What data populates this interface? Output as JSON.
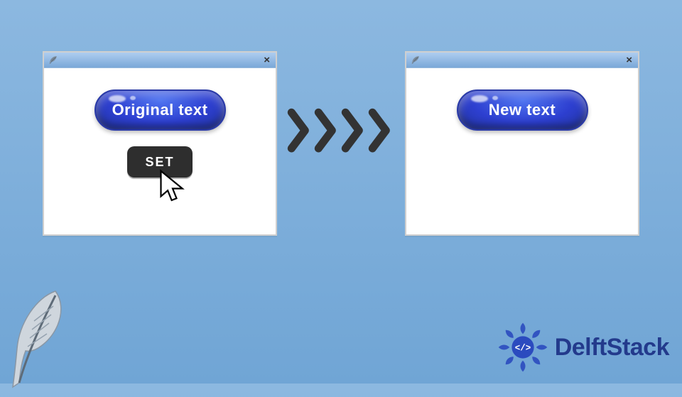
{
  "left_window": {
    "pill_label": "Original text",
    "set_label": "SET"
  },
  "right_window": {
    "pill_label": "New text"
  },
  "brand": {
    "name": "DelftStack"
  },
  "colors": {
    "background_top": "#8cb8e0",
    "background_bottom": "#70a5d5",
    "pill": "#2d3fd0",
    "set_button": "#2e2e2e",
    "chevron": "#333333",
    "brand": "#233a8c"
  }
}
